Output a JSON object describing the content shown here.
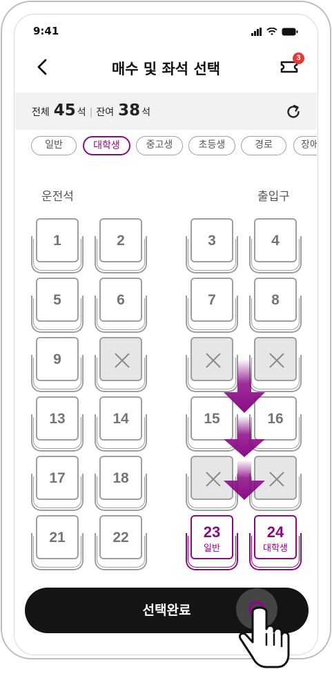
{
  "status": {
    "time": "9:41"
  },
  "header": {
    "title": "매수 및 좌석 선택",
    "badge": "3"
  },
  "summary": {
    "total_label": "전체",
    "total": "45",
    "unit1": "석",
    "sep": "|",
    "remain_label": "잔여",
    "remain": "38",
    "unit2": "석"
  },
  "filters": [
    "일반",
    "대학생",
    "중고생",
    "초등생",
    "경로",
    "장애"
  ],
  "zones": {
    "left": "운전석",
    "right": "출입구"
  },
  "seats": [
    "1",
    "2",
    "3",
    "4",
    "5",
    "6",
    "7",
    "8",
    "9",
    "13",
    "14",
    "15",
    "16",
    "17",
    "18",
    "21",
    "22"
  ],
  "picked": [
    {
      "number": "23",
      "type": "일반"
    },
    {
      "number": "24",
      "type": "대학생"
    }
  ],
  "cta": {
    "label": "선택완료"
  },
  "colors": {
    "accent": "#8a0a86",
    "dark": "#141414"
  }
}
